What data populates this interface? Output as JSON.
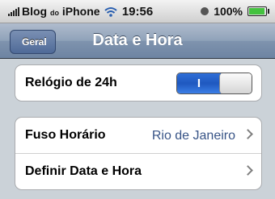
{
  "status_bar": {
    "carrier": "Blog",
    "carrier_small": "do",
    "carrier_suffix": "iPhone",
    "time": "19:56",
    "battery_percent": "100%"
  },
  "nav": {
    "back_label": "Geral",
    "title": "Data e Hora"
  },
  "settings": {
    "clock24": {
      "label": "Relógio de 24h",
      "switch_label": "I",
      "on": true
    },
    "timezone": {
      "label": "Fuso Horário",
      "value": "Rio de Janeiro"
    },
    "set_datetime": {
      "label": "Definir Data e Hora"
    }
  },
  "colors": {
    "nav_bar": "#7f93ae",
    "value_text": "#385487",
    "switch_on": "#2f6fd8",
    "battery": "#44c23f"
  }
}
